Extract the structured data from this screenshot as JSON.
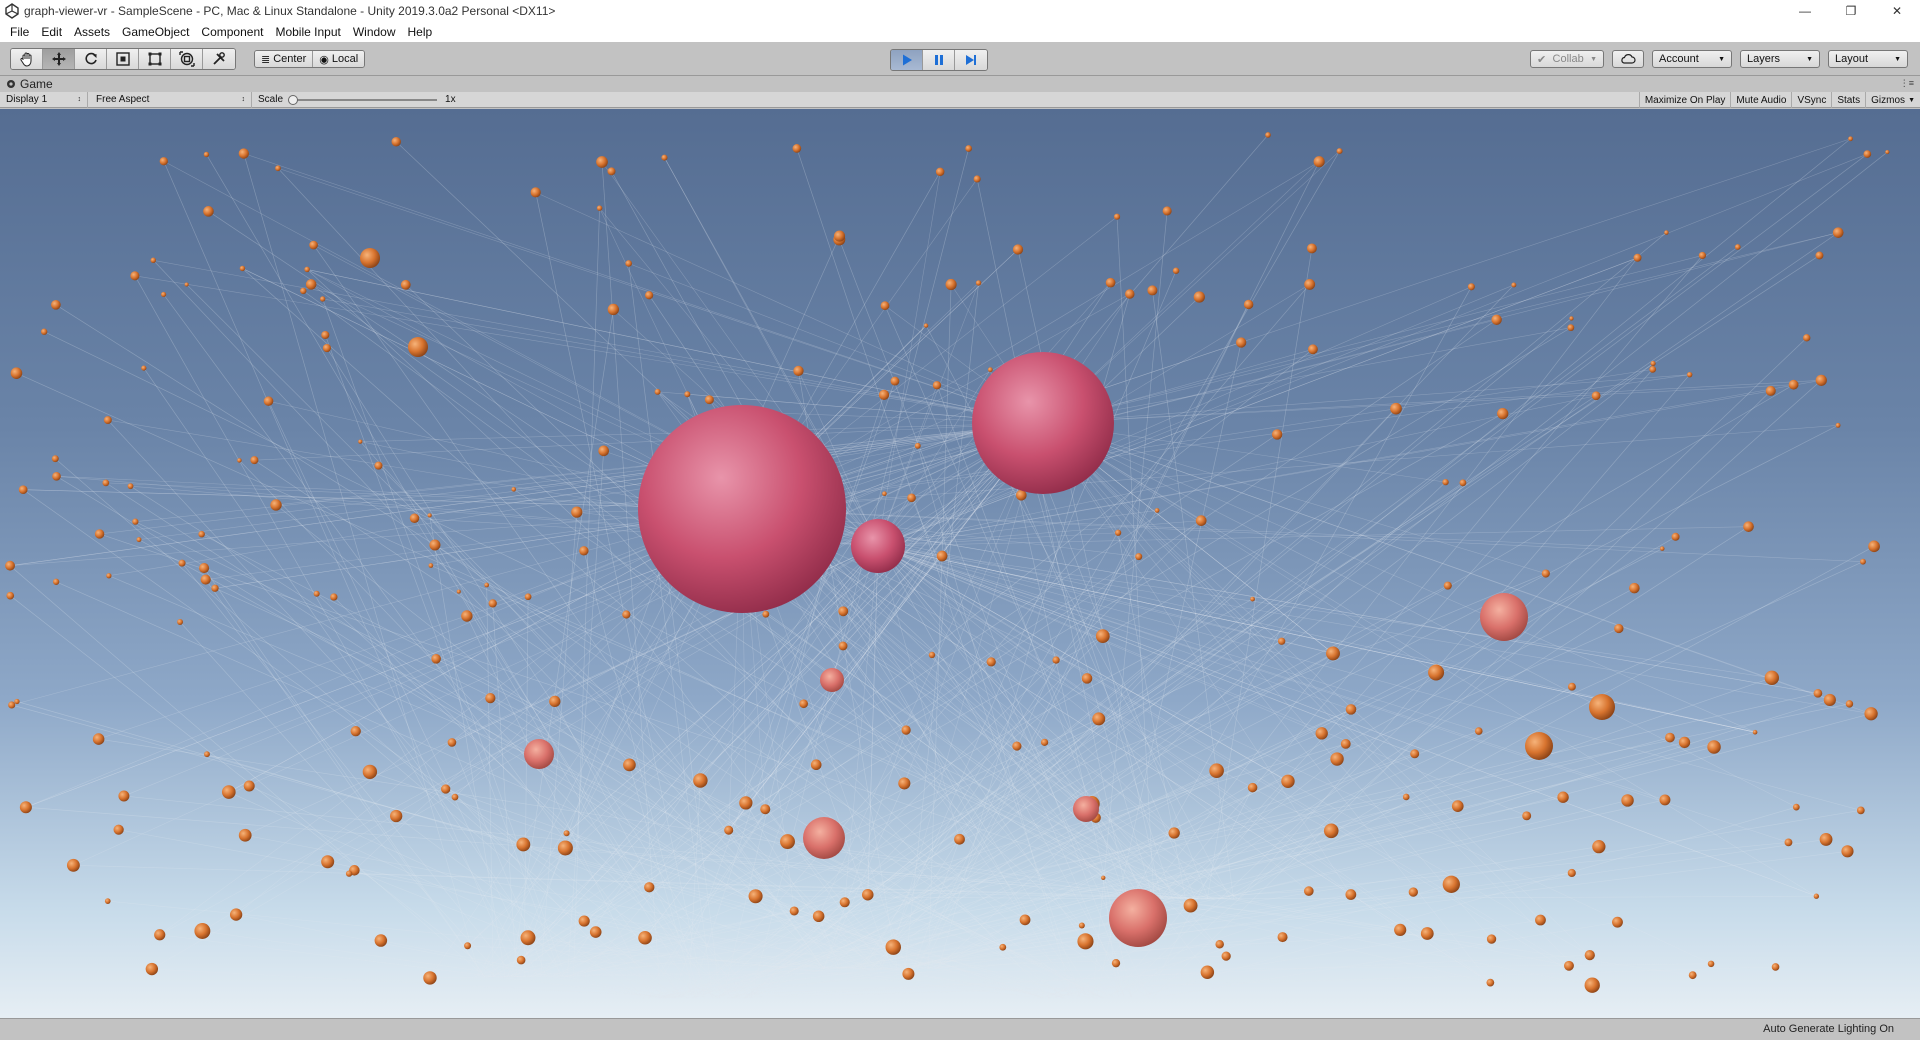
{
  "window": {
    "title": "graph-viewer-vr - SampleScene - PC, Mac & Linux Standalone - Unity 2019.3.0a2 Personal <DX11>",
    "icon": "unity-logo-icon"
  },
  "menu": {
    "items": [
      "File",
      "Edit",
      "Assets",
      "GameObject",
      "Component",
      "Mobile Input",
      "Window",
      "Help"
    ]
  },
  "toolbar": {
    "tools": [
      {
        "name": "hand-tool-icon"
      },
      {
        "name": "move-tool-icon"
      },
      {
        "name": "rotate-tool-icon"
      },
      {
        "name": "scale-tool-icon"
      },
      {
        "name": "rect-tool-icon"
      },
      {
        "name": "transform-tool-icon"
      },
      {
        "name": "custom-tool-icon"
      }
    ],
    "pivot_label": "Center",
    "space_label": "Local",
    "collab_label": "Collab",
    "account_label": "Account",
    "layers_label": "Layers",
    "layout_label": "Layout"
  },
  "game_view": {
    "tab_label": "Game",
    "display_label": "Display 1",
    "aspect_label": "Free Aspect",
    "scale_label": "Scale",
    "scale_value": "1x",
    "maximize_label": "Maximize On Play",
    "mute_label": "Mute Audio",
    "vsync_label": "VSync",
    "stats_label": "Stats",
    "gizmos_label": "Gizmos"
  },
  "status": {
    "text": "Auto Generate Lighting On"
  },
  "colors": {
    "play_active": "#2c7fe0",
    "sky_top": "#556d92",
    "sky_horizon": "#e6eef4",
    "node_small": "#e0843a",
    "node_large": "#d65a7a"
  }
}
